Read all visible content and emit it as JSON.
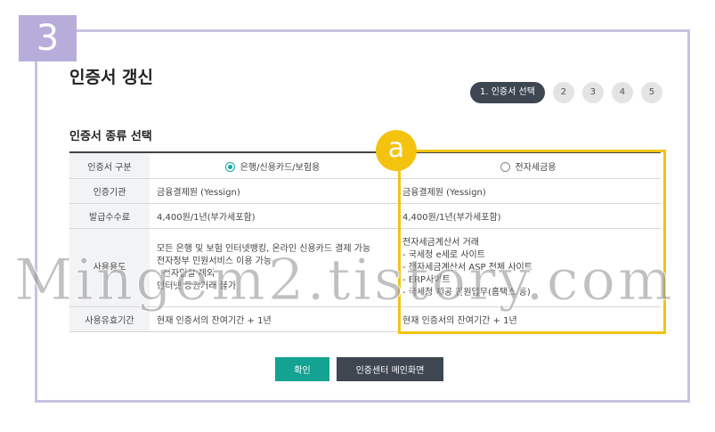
{
  "step_badge": "3",
  "page_title": "인증서 갱신",
  "steps": {
    "active": "1. 인증서 선택",
    "others": [
      "2",
      "3",
      "4",
      "5"
    ]
  },
  "section_title": "인증서 종류 선택",
  "table": {
    "header_label": "인증서 구분",
    "option_a": "은행/신용카드/보험용",
    "option_b": "전자세금용",
    "option_a_selected": true,
    "rows": [
      {
        "label": "인증기관",
        "a": "금융결제원 (Yessign)",
        "b": "금융결제원 (Yessign)"
      },
      {
        "label": "발급수수료",
        "a": "4,400원/1년(부가세포함)",
        "b": "4,400원/1년(부가세포함)"
      },
      {
        "label": "사용용도",
        "a_lines": [
          "모든 은행 및 보험 인터넷뱅킹, 온라인 신용카드 결제 가능",
          "전자정부 민원서비스 이용 가능",
          "- 전자입찰 제외",
          "인터넷 증권거래 불가"
        ],
        "b_lines": [
          "전자세금계산서 거래",
          "- 국세청 e세로 사이트",
          "- 전자세금계산서 ASP 전체 사이트",
          "- ERP사이트",
          "- 국세청 제공 민원업무(홈택스 등)"
        ]
      },
      {
        "label": "사용유효기간",
        "a": "현재 인증서의 잔여기간 + 1년",
        "b": "현재 인증서의 잔여기간 + 1년"
      }
    ]
  },
  "marker": "a",
  "buttons": {
    "confirm": "확인",
    "main": "인증센터 메인화면"
  },
  "watermark": "Mingem2.tistory.com",
  "colors": {
    "frame": "#c9c1e2",
    "badge": "#b7addb",
    "highlight": "#f4c310",
    "accent": "#14a392",
    "dark": "#3d4651"
  }
}
